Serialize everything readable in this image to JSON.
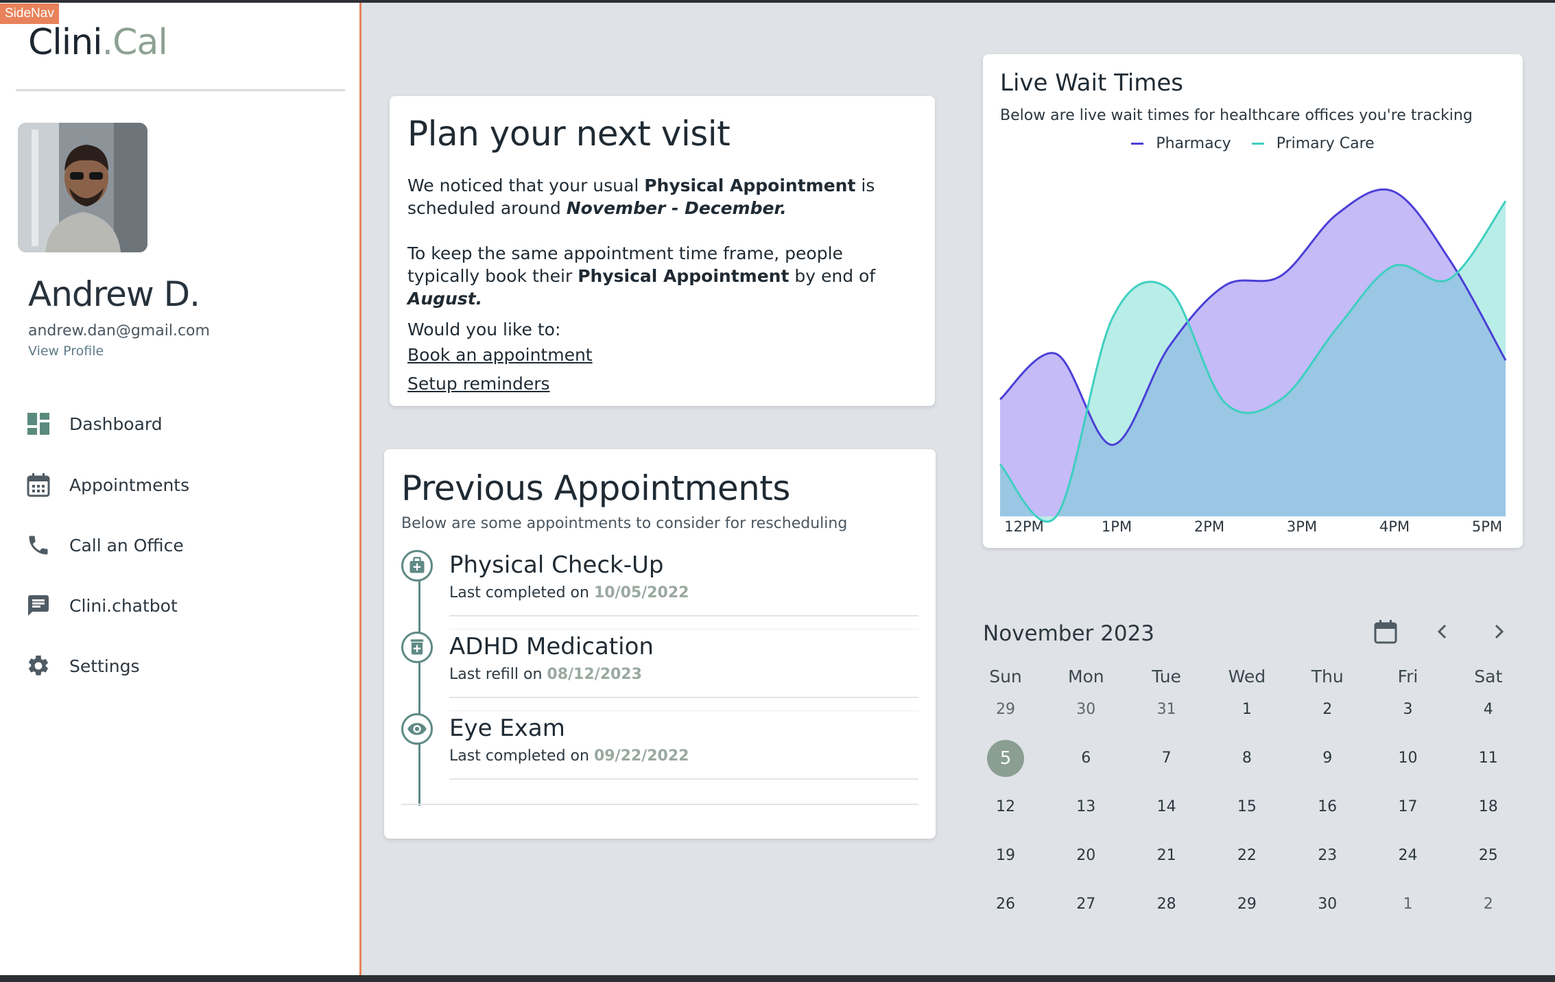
{
  "sidenav": {
    "tag": "SideNav",
    "brand": {
      "main": "Clini",
      "accent": ".Cal"
    },
    "user": {
      "name": "Andrew D.",
      "email": "andrew.dan@gmail.com",
      "view_profile": "View Profile"
    },
    "items": [
      {
        "label": "Dashboard",
        "icon": "dashboard-icon"
      },
      {
        "label": "Appointments",
        "icon": "calendar-icon"
      },
      {
        "label": "Call an Office",
        "icon": "phone-icon"
      },
      {
        "label": "Clini.chatbot",
        "icon": "chat-icon"
      },
      {
        "label": "Settings",
        "icon": "gear-icon"
      }
    ]
  },
  "plan": {
    "title": "Plan your next visit",
    "p1_a": "We noticed that your usual ",
    "p1_b": "Physical Appointment",
    "p1_c": " is scheduled around ",
    "p1_d": "November - December.",
    "p2_a": "To keep the same appointment time frame, people typically book their ",
    "p2_b": "Physical Appointment",
    "p2_c": " by end of ",
    "p2_d": "August.",
    "prompt": "Would you like to:",
    "link_book": "Book an appointment",
    "link_reminders": "Setup reminders"
  },
  "previous": {
    "title": "Previous Appointments",
    "subtitle": "Below are some appointments to consider for rescheduling",
    "items": [
      {
        "title": "Physical Check-Up",
        "meta": "Last completed on ",
        "date": "10/05/2022",
        "icon": "medical-bag-icon"
      },
      {
        "title": "ADHD Medication",
        "meta": "Last refill on ",
        "date": "08/12/2023",
        "icon": "pharmacy-icon"
      },
      {
        "title": "Eye Exam",
        "meta": "Last completed on ",
        "date": "09/22/2022",
        "icon": "eye-icon"
      }
    ]
  },
  "wait": {
    "title": "Live Wait Times",
    "subtitle": "Below are live wait times for healthcare offices you're tracking"
  },
  "colors": {
    "pharmacy": "#4b3fd6",
    "primary_care": "#3fcfc0",
    "accent": "#e8825a",
    "brand_green": "#8da194"
  },
  "chart_data": {
    "type": "area",
    "x": [
      "12:00PM",
      "12:30PM",
      "1:00PM",
      "1:30PM",
      "2:00PM",
      "2:30PM",
      "3:00PM",
      "3:30PM",
      "4:00PM",
      "4:30PM",
      "5:00PM"
    ],
    "tick_labels": [
      "12PM",
      "1PM",
      "2PM",
      "3PM",
      "4PM",
      "5PM"
    ],
    "ylim": [
      0,
      100
    ],
    "legend": "top-center",
    "grid": false,
    "series": [
      {
        "name": "Pharmacy",
        "color": "#4b3fd6",
        "values": [
          36,
          50,
          22,
          52,
          71,
          74,
          93,
          100,
          79,
          48
        ]
      },
      {
        "name": "Primary Care",
        "color": "#3fcfc0",
        "values": [
          16,
          0,
          61,
          70,
          35,
          36,
          58,
          77,
          73,
          97
        ]
      }
    ]
  },
  "calendar": {
    "month": "November 2023",
    "weekdays": [
      "Sun",
      "Mon",
      "Tue",
      "Wed",
      "Thu",
      "Fri",
      "Sat"
    ],
    "weeks": [
      [
        "29",
        "30",
        "31",
        "1",
        "2",
        "3",
        "4"
      ],
      [
        "5",
        "6",
        "7",
        "8",
        "9",
        "10",
        "11"
      ],
      [
        "12",
        "13",
        "14",
        "15",
        "16",
        "17",
        "18"
      ],
      [
        "19",
        "20",
        "21",
        "22",
        "23",
        "24",
        "25"
      ],
      [
        "26",
        "27",
        "28",
        "29",
        "30",
        "1",
        "2"
      ]
    ],
    "selected": "5"
  }
}
